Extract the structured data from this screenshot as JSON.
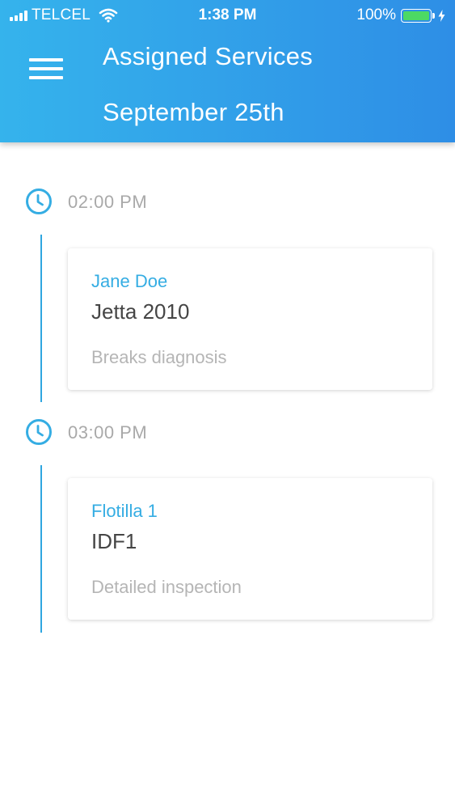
{
  "status_bar": {
    "carrier": "TELCEL",
    "time": "1:38 PM",
    "battery": "100%",
    "battery_level": 1.0,
    "icons": [
      "signal-icon",
      "wifi-icon",
      "battery-icon",
      "charging-icon"
    ]
  },
  "header": {
    "menu_icon": "hamburger-menu-icon",
    "title": "Assigned Services",
    "date": "September 25th"
  },
  "colors": {
    "header_gradient_start": "#35b3ec",
    "header_gradient_end": "#2e8ee6",
    "accent": "#35ade3",
    "muted_text": "#b5b5b5"
  },
  "services": [
    {
      "time": "02:00 PM",
      "client": "Jane Doe",
      "vehicle": "Jetta 2010",
      "service": "Breaks diagnosis"
    },
    {
      "time": "03:00 PM",
      "client": "Flotilla 1",
      "vehicle": "IDF1",
      "service": "Detailed inspection"
    }
  ]
}
